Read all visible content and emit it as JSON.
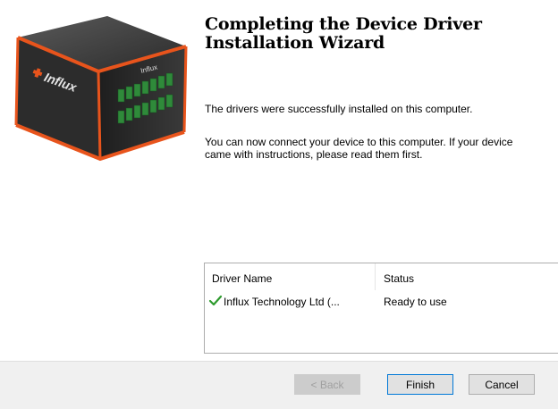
{
  "wizard": {
    "title_line1": "Completing the Device Driver",
    "title_line2": "Installation Wizard",
    "message1": "The drivers were successfully installed on this computer.",
    "message2_line1": "You can now connect your device to this computer. If your device",
    "message2_line2": "came with instructions, please read them first.",
    "device_logo": "Influx"
  },
  "driver_table": {
    "columns": [
      "Driver Name",
      "Status"
    ],
    "rows": [
      {
        "icon": "green-checkmark-icon",
        "name": "Influx Technology Ltd (...",
        "status": "Ready to use"
      }
    ]
  },
  "buttons": {
    "back": "< Back",
    "finish": "Finish",
    "cancel": "Cancel"
  },
  "colors": {
    "check_green": "#2e9b2e",
    "accent_orange": "#e8541c",
    "device_body": "#2a2a2a",
    "connector_green": "#2f8a3a"
  }
}
